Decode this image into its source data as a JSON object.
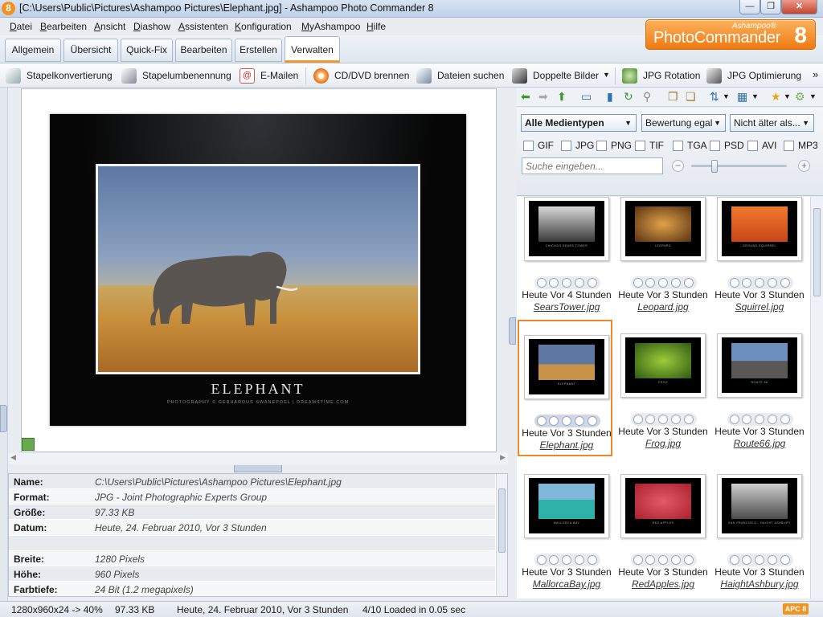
{
  "window": {
    "title": "[C:\\Users\\Public\\Pictures\\Ashampoo Pictures\\Elephant.jpg] - Ashampoo Photo Commander 8",
    "app_icon": "8",
    "minimize": "—",
    "maximize": "❐",
    "close": "✕"
  },
  "menu": [
    {
      "u": "D",
      "rest": "atei"
    },
    {
      "u": "B",
      "rest": "earbeiten"
    },
    {
      "u": "A",
      "rest": "nsicht"
    },
    {
      "u": "D",
      "rest": "iashow"
    },
    {
      "u": "A",
      "rest": "ssistenten"
    },
    {
      "u": "K",
      "rest": "onfiguration"
    },
    {
      "u": "M",
      "rest": "yAshampoo"
    },
    {
      "u": "H",
      "rest": "ilfe"
    }
  ],
  "brand": {
    "small": "Ashampoo®",
    "name": "PhotoCommander",
    "version": "8"
  },
  "tabs": [
    "Allgemein",
    "Übersicht",
    "Quick-Fix",
    "Bearbeiten",
    "Erstellen",
    "Verwalten"
  ],
  "active_tab": "Verwalten",
  "toolbar": {
    "batch_convert": "Stapelkonvertierung",
    "batch_rename": "Stapelumbenennung",
    "email": "E-Mailen",
    "burn": "CD/DVD brennen",
    "find_files": "Dateien suchen",
    "duplicates": "Doppelte Bilder",
    "jpg_rotation": "JPG Rotation",
    "jpg_optimize": "JPG Optimierung",
    "overflow": "»"
  },
  "preview": {
    "poster_title": "ELEPHANT",
    "poster_credit": "PHOTOGRAPHY © GERHARDUS SWANEPOEL | DREAMSTIME.COM"
  },
  "info": [
    {
      "key": "Name:",
      "value": "C:\\Users\\Public\\Pictures\\Ashampoo Pictures\\Elephant.jpg"
    },
    {
      "key": "Format:",
      "value": "JPG - Joint Photographic Experts Group"
    },
    {
      "key": "Größe:",
      "value": "97.33 KB"
    },
    {
      "key": "Datum:",
      "value": "Heute, 24. Februar 2010, Vor 3 Stunden"
    },
    {
      "key": "",
      "value": ""
    },
    {
      "key": "Breite:",
      "value": "1280 Pixels"
    },
    {
      "key": "Höhe:",
      "value": "960 Pixels"
    },
    {
      "key": "Farbtiefe:",
      "value": "24 Bit (1.2 megapixels)"
    }
  ],
  "filters": {
    "media_type": "Alle Medientypen",
    "rating": "Bewertung egal",
    "age": "Nicht älter als...",
    "types": [
      "GIF",
      "JPG",
      "PNG",
      "TIF",
      "TGA",
      "PSD",
      "AVI",
      "MP3"
    ],
    "search_placeholder": "Suche eingeben..."
  },
  "gallery": [
    {
      "date": "Heute Vor 4 Stunden",
      "name": "SearsTower.jpg",
      "cap": "CHICAGO SEARS TOWER",
      "c1": "#d8d8d8",
      "c2": "#3a3a3a"
    },
    {
      "date": "Heute Vor 3 Stunden",
      "name": "Leopard.jpg",
      "cap": "LEOPARD",
      "c1": "#e0a24a",
      "c2": "#5a3211"
    },
    {
      "date": "Heute Vor 3 Stunden",
      "name": "Squirrel.jpg",
      "cap": "GROUND SQUIRREL",
      "c1": "#f07a2c",
      "c2": "#c8461a"
    },
    {
      "date": "Heute Vor 3 Stunden",
      "name": "Elephant.jpg",
      "cap": "ELEPHANT",
      "c1": "#5d78a2",
      "c2": "#c89348"
    },
    {
      "date": "Heute Vor 3 Stunden",
      "name": "Frog.jpg",
      "cap": "FROG",
      "c1": "#9ccc3a",
      "c2": "#2e5a12"
    },
    {
      "date": "Heute Vor 3 Stunden",
      "name": "Route66.jpg",
      "cap": "ROUTE 66",
      "c1": "#6d8fc0",
      "c2": "#5a5854"
    },
    {
      "date": "Heute Vor 3 Stunden",
      "name": "MallorcaBay.jpg",
      "cap": "MALLORCA BAY",
      "c1": "#7fb8d8",
      "c2": "#2fb0a8"
    },
    {
      "date": "Heute Vor 3 Stunden",
      "name": "RedApples.jpg",
      "cap": "RED APPLES",
      "c1": "#e65a68",
      "c2": "#a8202e"
    },
    {
      "date": "Heute Vor 3 Stunden",
      "name": "HaightAshbury.jpg",
      "cap": "SAN FRANCISCO - HAIGHT ASHBURY",
      "c1": "#cfcfcf",
      "c2": "#4a4a4a"
    }
  ],
  "selected_file": "Elephant.jpg",
  "status": {
    "dims": "1280x960x24 -> 40%",
    "size": "97.33 KB",
    "date": "Heute, 24. Februar 2010, Vor 3 Stunden",
    "loaded": "4/10  Loaded in 0.05 sec",
    "badge": "APC 8"
  },
  "colors": {
    "accent": "#f39a2e",
    "brand": "#f07a10"
  }
}
